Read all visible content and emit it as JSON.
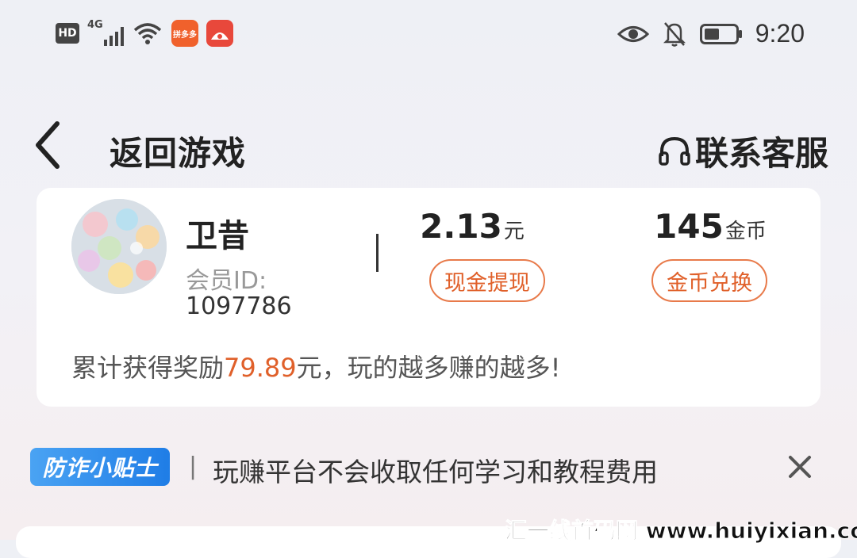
{
  "status_bar": {
    "hd": "HD",
    "network": "4G",
    "app_icon_text": "拼多多",
    "time": "9:20"
  },
  "nav": {
    "title": "返回游戏",
    "customer_service": "联系客服"
  },
  "profile": {
    "name": "卫昔",
    "member_label": "会员ID:",
    "member_id": "1097786"
  },
  "stats": {
    "cash_value": "2.13",
    "cash_unit": "元",
    "cash_button": "现金提现",
    "coin_value": "145",
    "coin_unit": "金币",
    "coin_button": "金币兑换"
  },
  "reward": {
    "prefix": "累计获得奖励",
    "amount": "79.89",
    "suffix": "元，玩的越多赚的越多!"
  },
  "tip": {
    "badge": "防诈小贴士",
    "separator": "|",
    "text": "玩赚平台不会收取任何学习和教程费用"
  },
  "watermark": "汇一线首码网 www.huiyixian.com",
  "colors": {
    "accent": "#e0602a",
    "tip_badge": "#2a88ea",
    "card": "#ffffff"
  },
  "icons": [
    "back-chevron-icon",
    "headset-icon",
    "close-icon",
    "eye-icon",
    "bell-off-icon",
    "battery-icon",
    "wifi-icon",
    "signal-icon"
  ]
}
